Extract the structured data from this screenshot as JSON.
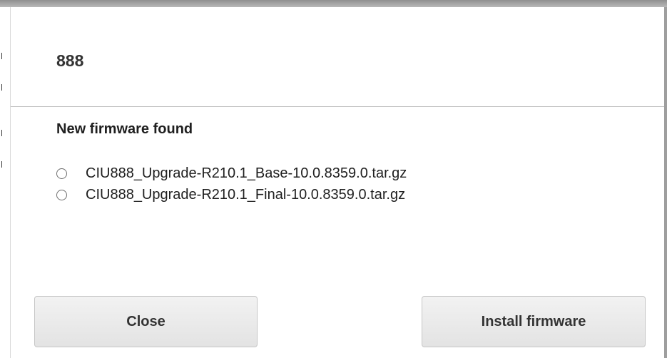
{
  "dialog": {
    "title": "888",
    "section_heading": "New firmware found",
    "firmware_options": [
      {
        "label": "CIU888_Upgrade-R210.1_Base-10.0.8359.0.tar.gz",
        "selected": false
      },
      {
        "label": "CIU888_Upgrade-R210.1_Final-10.0.8359.0.tar.gz",
        "selected": false
      }
    ],
    "buttons": {
      "close_label": "Close",
      "install_label": "Install firmware"
    }
  },
  "colors": {
    "backdrop": "#a7a7a7",
    "dialog_background": "#ffffff",
    "button_background": "#e9e9e9",
    "text": "#333333"
  }
}
